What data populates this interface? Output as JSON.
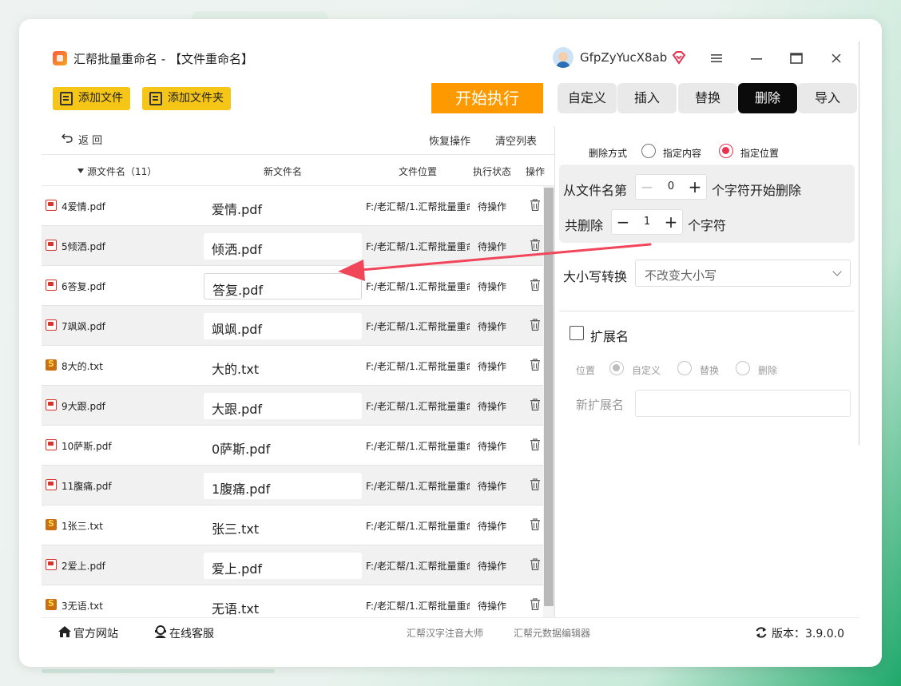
{
  "window": {
    "title": "汇帮批量重命名 - 【文件重命名】",
    "username": "GfpZyYucX8ab",
    "icons": {
      "logo": "app-logo-icon",
      "vip": "vip-diamond-icon",
      "menu": "menu-icon",
      "minimize": "minimize-icon",
      "maximize": "maximize-icon",
      "close": "close-icon"
    }
  },
  "toolbar": {
    "add_files": "添加文件",
    "add_folder": "添加文件夹",
    "start": "开始执行"
  },
  "tabs": [
    {
      "label": "自定义",
      "active": false
    },
    {
      "label": "插入",
      "active": false
    },
    {
      "label": "替换",
      "active": false
    },
    {
      "label": "删除",
      "active": true
    },
    {
      "label": "导入",
      "active": false
    }
  ],
  "list_actions": {
    "back": "返 回",
    "restore": "恢复操作",
    "clear": "清空列表"
  },
  "table": {
    "headers": {
      "source": "源文件名（11）",
      "new_name": "新文件名",
      "location": "文件位置",
      "status": "执行状态",
      "action": "操作"
    },
    "rows": [
      {
        "type": "pdf",
        "source": "4爱情.pdf",
        "new_name": "爱情.pdf",
        "location": "F:/老汇帮/1.汇帮批量重命名",
        "status": "待操作"
      },
      {
        "type": "pdf",
        "source": "5倾洒.pdf",
        "new_name": "倾洒.pdf",
        "location": "F:/老汇帮/1.汇帮批量重命名",
        "status": "待操作"
      },
      {
        "type": "pdf",
        "source": "6答复.pdf",
        "new_name": "答复.pdf",
        "location": "F:/老汇帮/1.汇帮批量重命名",
        "status": "待操作"
      },
      {
        "type": "pdf",
        "source": "7飒飒.pdf",
        "new_name": "飒飒.pdf",
        "location": "F:/老汇帮/1.汇帮批量重命名",
        "status": "待操作"
      },
      {
        "type": "txt",
        "source": "8大的.txt",
        "new_name": "大的.txt",
        "location": "F:/老汇帮/1.汇帮批量重命名",
        "status": "待操作"
      },
      {
        "type": "pdf",
        "source": "9大跟.pdf",
        "new_name": "大跟.pdf",
        "location": "F:/老汇帮/1.汇帮批量重命名",
        "status": "待操作"
      },
      {
        "type": "pdf",
        "source": "10萨斯.pdf",
        "new_name": "0萨斯.pdf",
        "location": "F:/老汇帮/1.汇帮批量重命名",
        "status": "待操作"
      },
      {
        "type": "pdf",
        "source": "11腹痛.pdf",
        "new_name": "1腹痛.pdf",
        "location": "F:/老汇帮/1.汇帮批量重命名",
        "status": "待操作"
      },
      {
        "type": "txt",
        "source": "1张三.txt",
        "new_name": "张三.txt",
        "location": "F:/老汇帮/1.汇帮批量重命名",
        "status": "待操作"
      },
      {
        "type": "pdf",
        "source": "2爱上.pdf",
        "new_name": "爱上.pdf",
        "location": "F:/老汇帮/1.汇帮批量重命名",
        "status": "待操作"
      },
      {
        "type": "txt",
        "source": "3无语.txt",
        "new_name": "无语.txt",
        "location": "F:/老汇帮/1.汇帮批量重命名",
        "status": "待操作"
      }
    ]
  },
  "delete_panel": {
    "mode_label": "删除方式",
    "mode_options": [
      "指定内容",
      "指定位置"
    ],
    "mode_selected": "指定位置",
    "from_label": "从文件名第",
    "from_value": "0",
    "from_suffix": "个字符开始删除",
    "count_label": "共删除",
    "count_value": "1",
    "count_suffix": "个字符",
    "case_label": "大小写转换",
    "case_value": "不改变大小写",
    "ext_label": "扩展名",
    "ext_checked": false,
    "position_label": "位置",
    "position_options": [
      "自定义",
      "替换",
      "删除"
    ],
    "position_selected": "自定义",
    "new_ext_label": "新扩展名",
    "new_ext_value": ""
  },
  "footer": {
    "website": "官方网站",
    "support": "在线客服",
    "tool1": "汇帮汉字注音大师",
    "tool2": "汇帮元数据编辑器",
    "version": "版本：3.9.0.0"
  },
  "colors": {
    "accent_yellow": "#f5c518",
    "start_orange": "#fe9a00",
    "active_tab": "#0b0b0b",
    "radio_selected": "#e8334f",
    "annotation_arrow": "#f1465a"
  }
}
